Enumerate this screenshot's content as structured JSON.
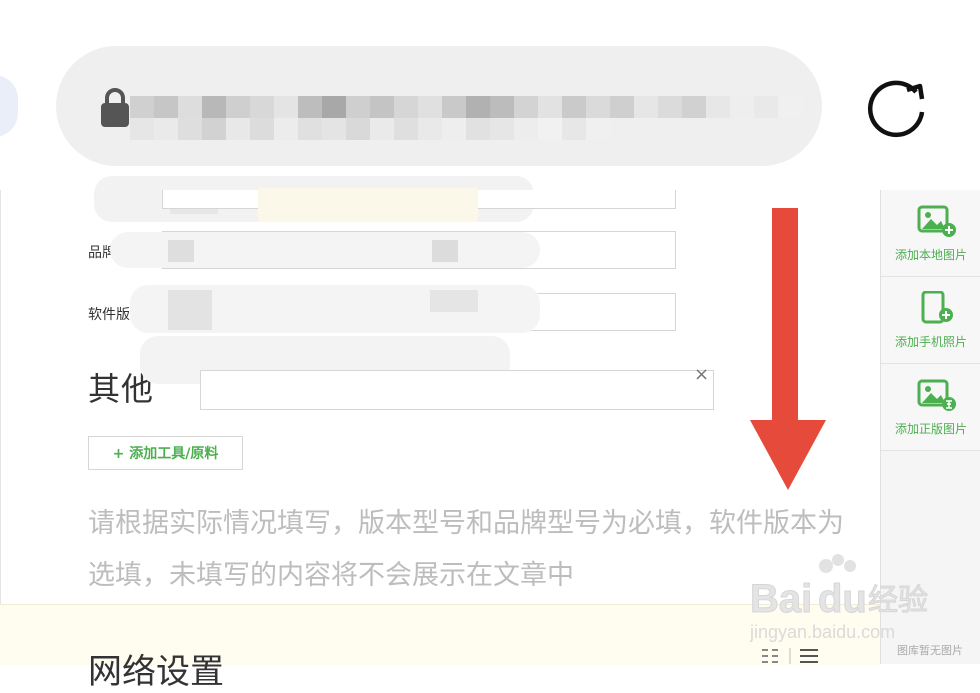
{
  "fields": {
    "brand_label": "品牌",
    "software_label": "软件版"
  },
  "other": {
    "title": "其他",
    "clear_symbol": "×",
    "add_tool_label": "+ 添加工具/原料",
    "hint": "请根据实际情况填写，版本型号和品牌型号为必填，软件版本为选填，未填写的内容将不会展示在文章中"
  },
  "sidebar": {
    "items": [
      {
        "label": "添加本地图片",
        "icon": "image-add-icon"
      },
      {
        "label": "添加手机照片",
        "icon": "phone-add-icon"
      },
      {
        "label": "添加正版图片",
        "icon": "image-licensed-icon"
      }
    ],
    "empty_label": "图库暂无图片"
  },
  "bottom": {
    "title": "网络设置"
  },
  "watermark": {
    "brand": "Baidu经验",
    "url": "jingyan.baidu.com"
  },
  "colors": {
    "accent_green": "#4caf50",
    "arrow_red": "#e64a3b",
    "hint_gray": "#bdbdbd"
  }
}
